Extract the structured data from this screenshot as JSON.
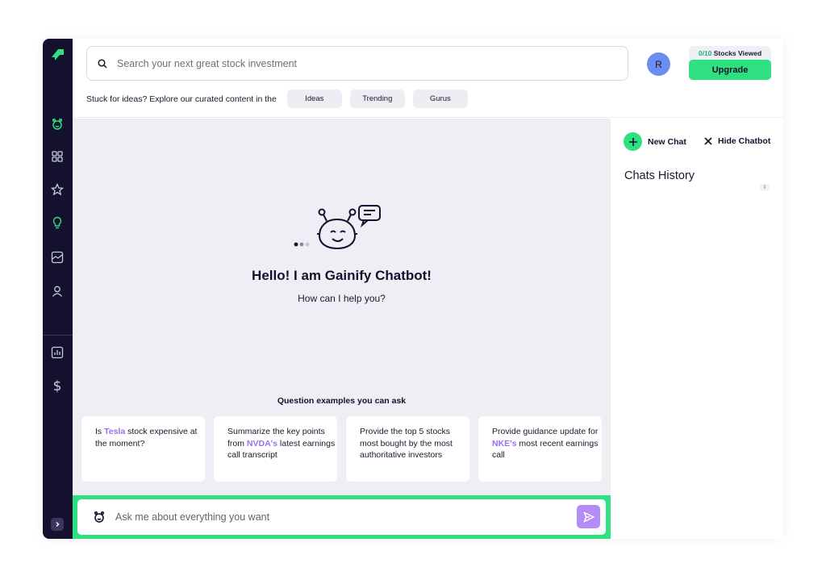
{
  "header": {
    "search_placeholder": "Search your next great stock investment",
    "avatar_initial": "R",
    "stocks_viewed_count": "0/10",
    "stocks_viewed_label": " Stocks Viewed",
    "upgrade_label": "Upgrade",
    "ideas_prompt": "Stuck for ideas? Explore our curated content in the",
    "chips": [
      "Ideas",
      "Trending",
      "Gurus"
    ]
  },
  "sidebar": {
    "icons": [
      "logo-icon",
      "chatbot-icon",
      "dashboard-icon",
      "star-icon",
      "lightbulb-icon",
      "chart-line-icon",
      "user-icon",
      "bar-chart-icon",
      "dollar-icon",
      "chevron-right-icon"
    ],
    "active_item": "chatbot"
  },
  "main": {
    "greeting": "Hello! I am Gainify Chatbot!",
    "subtitle": "How can I help you?",
    "questions_title": "Question examples you can ask",
    "cards": [
      {
        "pre": "Is ",
        "hl": "Tesla",
        "post": " stock expensive at the moment?"
      },
      {
        "pre": "Summarize the key points from ",
        "hl": "NVDA's",
        "post": " latest earnings call transcript"
      },
      {
        "pre": "Provide the top 5 stocks most bought by the most authoritative investors",
        "hl": "",
        "post": ""
      },
      {
        "pre": "Provide guidance update for ",
        "hl": "NKE's",
        "post": " most recent earnings call"
      }
    ],
    "chat_placeholder": "Ask me about everything you want"
  },
  "right_panel": {
    "new_chat_label": "New Chat",
    "hide_chatbot_label": "Hide Chatbot",
    "history_title": "Chats History"
  },
  "colors": {
    "sidebar_bg": "#14112e",
    "accent_green": "#2ee07f",
    "accent_purple": "#9a6ef0",
    "main_bg": "#eeeff5"
  }
}
